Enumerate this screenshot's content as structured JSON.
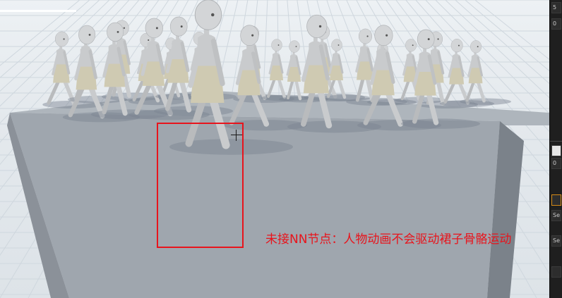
{
  "viewport": {
    "annotation_text": "未接NN节点：人物动画不会驱动裙子骨骼运动"
  },
  "right_panel": {
    "items": [
      {
        "label": "5"
      },
      {
        "label": "0"
      },
      {
        "label": ""
      },
      {
        "label": "0"
      },
      {
        "label": ""
      },
      {
        "label": "Se"
      },
      {
        "label": "Se"
      },
      {
        "label": ""
      }
    ]
  },
  "colors": {
    "annotation": "#e8141c",
    "selection_box": "#e8141c",
    "platform_top": "#9fa6ae",
    "platform_side": "#7b828a",
    "character": "#c9cbcd",
    "skirt": "#cfcab2",
    "panel_bg": "#1f1f1f"
  },
  "icons": {
    "crosshair": "crosshair-icon"
  }
}
